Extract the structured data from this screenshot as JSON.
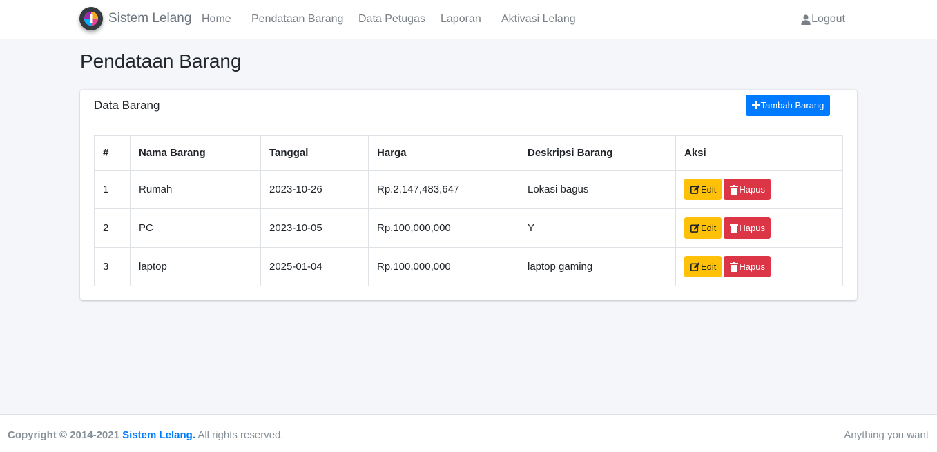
{
  "navbar": {
    "brand": "Sistem Lelang",
    "links": [
      "Home",
      "Pendataan Barang",
      "Data Petugas",
      "Laporan",
      "Aktivasi Lelang"
    ],
    "logout": "Logout"
  },
  "page": {
    "title": "Pendataan Barang"
  },
  "card": {
    "title": "Data Barang",
    "add_button": "Tambah Barang"
  },
  "table": {
    "headers": [
      "#",
      "Nama Barang",
      "Tanggal",
      "Harga",
      "Deskripsi Barang",
      "Aksi"
    ],
    "rows": [
      {
        "no": "1",
        "nama": "Rumah",
        "tanggal": "2023-10-26",
        "harga": "Rp.2,147,483,647",
        "deskripsi": "Lokasi bagus"
      },
      {
        "no": "2",
        "nama": "PC",
        "tanggal": "2023-10-05",
        "harga": "Rp.100,000,000",
        "deskripsi": "Y"
      },
      {
        "no": "3",
        "nama": "laptop",
        "tanggal": "2025-01-04",
        "harga": "Rp.100,000,000",
        "deskripsi": "laptop gaming"
      }
    ],
    "edit_label": "Edit",
    "delete_label": "Hapus"
  },
  "footer": {
    "copyright_prefix": "Copyright © 2014-2021",
    "brand": "Sistem Lelang.",
    "rights": "All rights reserved.",
    "right_text": "Anything you want"
  },
  "colors": {
    "primary": "#007bff",
    "warning": "#ffc107",
    "danger": "#dc3545",
    "background": "#f4f6f9"
  }
}
